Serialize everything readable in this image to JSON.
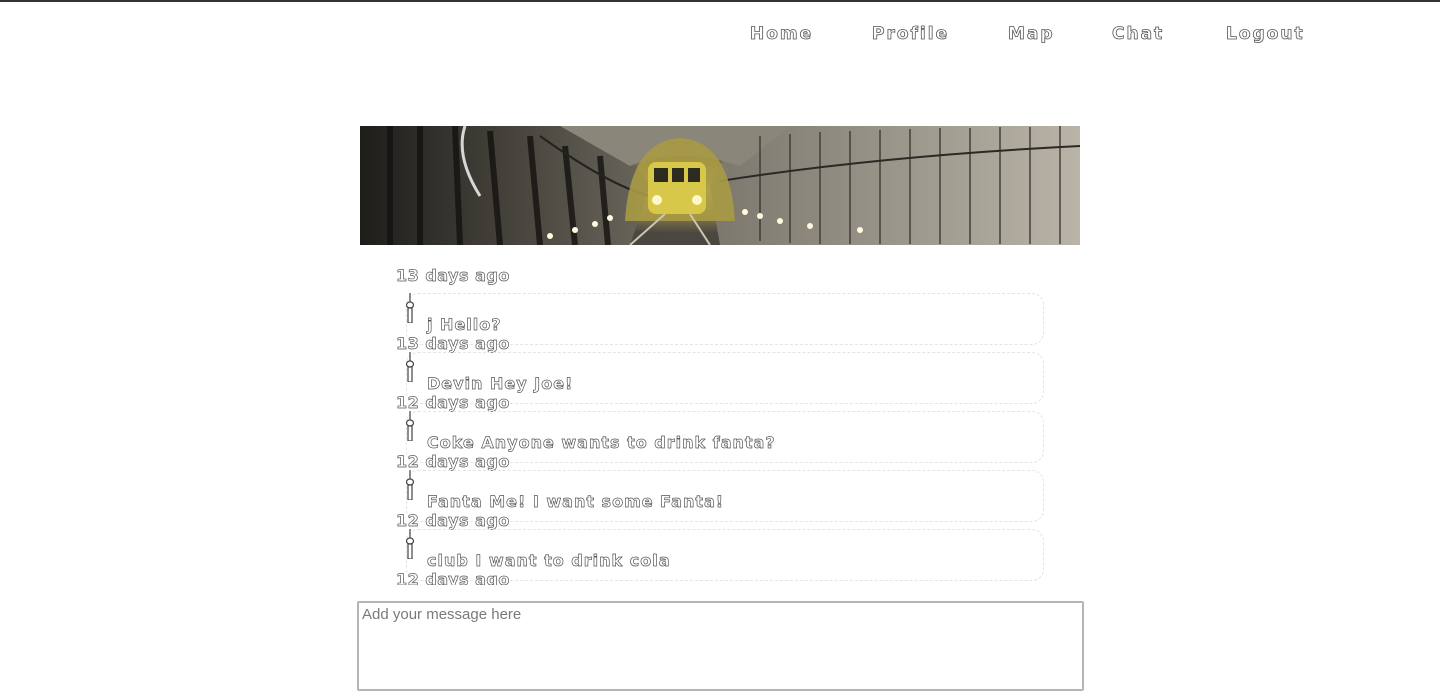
{
  "nav": {
    "home": "Home",
    "profile": "Profile",
    "map": "Map",
    "chat": "Chat",
    "logout": "Logout"
  },
  "banner": {
    "alt": "Subway train in a tunnel",
    "colors": {
      "tunnel": "#57534b",
      "train": "#d8c84a",
      "lights": "#fff7c7"
    }
  },
  "chat": {
    "first_timestamp": "13 days ago",
    "messages": [
      {
        "text": "j Hello?",
        "timestamp": "13 days ago"
      },
      {
        "text": "Devin Hey Joe!",
        "timestamp": "12 days ago"
      },
      {
        "text": "Coke Anyone wants to drink fanta?",
        "timestamp": "12 days ago"
      },
      {
        "text": "Fanta Me! I want some Fanta!",
        "timestamp": "12 days ago"
      },
      {
        "text": "club I want to drink cola",
        "timestamp": "12 days ago"
      }
    ]
  },
  "composer": {
    "placeholder": "Add your message here"
  }
}
